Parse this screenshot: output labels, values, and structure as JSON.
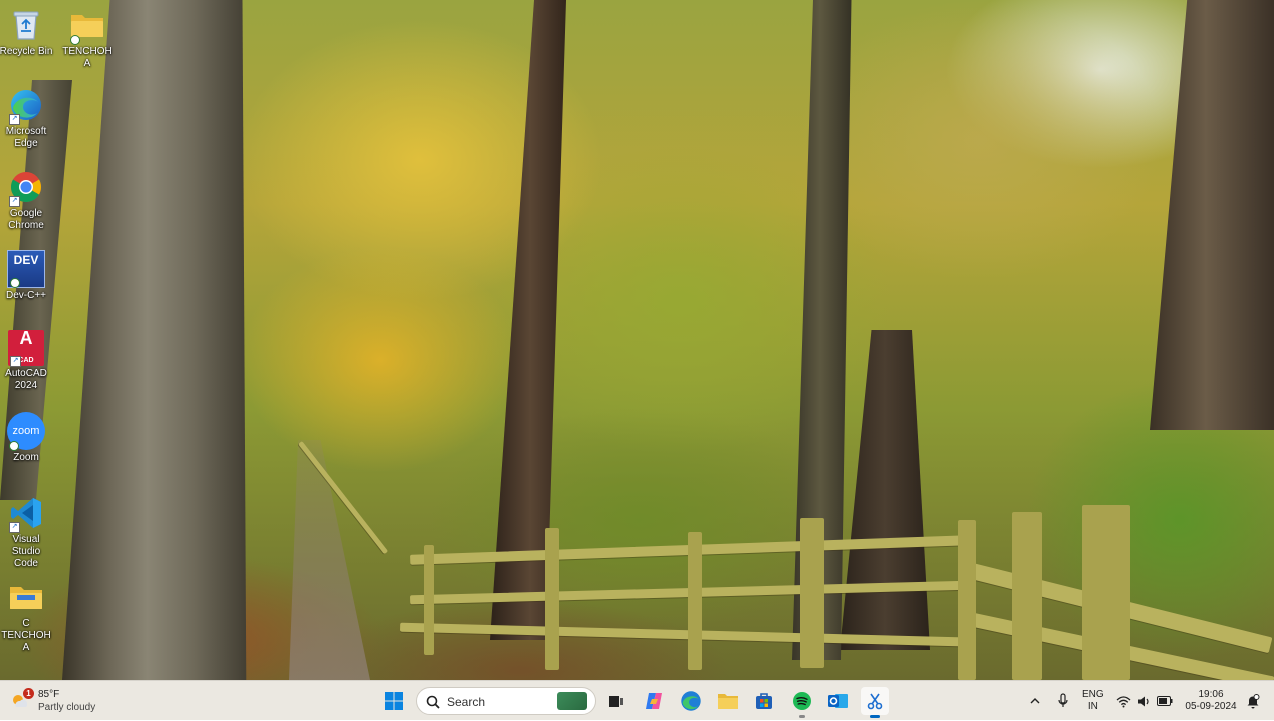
{
  "desktop": {
    "icons": [
      {
        "id": "recycle-bin",
        "label": "Recycle Bin"
      },
      {
        "id": "user-folder",
        "label": "TENCHOHA"
      },
      {
        "id": "edge",
        "label": "Microsoft Edge"
      },
      {
        "id": "chrome",
        "label": "Google Chrome"
      },
      {
        "id": "devcpp",
        "label": "Dev-C++",
        "glyph_text": "DEV"
      },
      {
        "id": "autocad",
        "label": "AutoCAD 2024",
        "glyph_text": "A",
        "glyph_sub": "CAD"
      },
      {
        "id": "zoom",
        "label": "Zoom",
        "glyph_text": "zoom"
      },
      {
        "id": "vscode",
        "label": "Visual Studio Code"
      },
      {
        "id": "c-folder",
        "label": "C TENCHOHA"
      }
    ]
  },
  "taskbar": {
    "weather": {
      "temp": "85°F",
      "condition": "Partly cloudy",
      "badge": "1"
    },
    "search": {
      "placeholder": "Search"
    },
    "apps": [
      {
        "id": "start",
        "name": "Start"
      },
      {
        "id": "task-view",
        "name": "Task View"
      },
      {
        "id": "copilot",
        "name": "Copilot"
      },
      {
        "id": "edge",
        "name": "Microsoft Edge"
      },
      {
        "id": "file-explorer",
        "name": "File Explorer"
      },
      {
        "id": "store",
        "name": "Microsoft Store"
      },
      {
        "id": "spotify",
        "name": "Spotify"
      },
      {
        "id": "outlook",
        "name": "Outlook"
      },
      {
        "id": "snipping-tool",
        "name": "Snipping Tool"
      }
    ],
    "tray": {
      "language_line1": "ENG",
      "language_line2": "IN",
      "time": "19:06",
      "date": "05-09-2024"
    }
  },
  "colors": {
    "taskbar_bg": "#ebe8e1",
    "accent": "#0067c0"
  }
}
